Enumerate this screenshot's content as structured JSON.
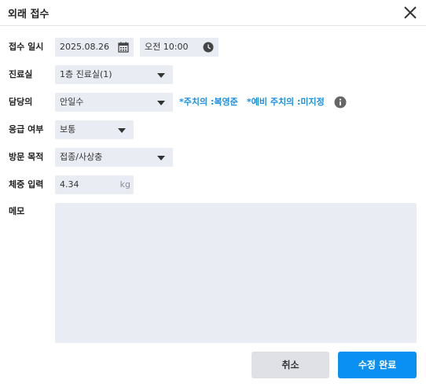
{
  "dialog": {
    "title": "외래 접수"
  },
  "visit_datetime": {
    "label": "접수 일시",
    "date": "2025.08.26",
    "time": "오전 10:00"
  },
  "room": {
    "label": "진료실",
    "value": "1층 진료실(1)"
  },
  "doctor": {
    "label": "담당의",
    "value": "안일수",
    "primary_note": "*주치의 :복영준",
    "backup_note": "*예비 주치의 :미지정"
  },
  "urgency": {
    "label": "응급 여부",
    "value": "보통"
  },
  "visit_purpose": {
    "label": "방문 목적",
    "value": "접종/사상충"
  },
  "weight": {
    "label": "체중 입력",
    "value": "4.34",
    "unit": "kg"
  },
  "memo": {
    "label": "메모",
    "value": ""
  },
  "buttons": {
    "cancel": "취소",
    "confirm": "수정 완료"
  },
  "colors": {
    "accent": "#0a8ff2",
    "field_bg": "#e9ecf3",
    "note": "#1a8fe3"
  },
  "icons": [
    "close-icon",
    "calendar-icon",
    "clock-icon",
    "chevron-down-icon",
    "info-icon"
  ]
}
